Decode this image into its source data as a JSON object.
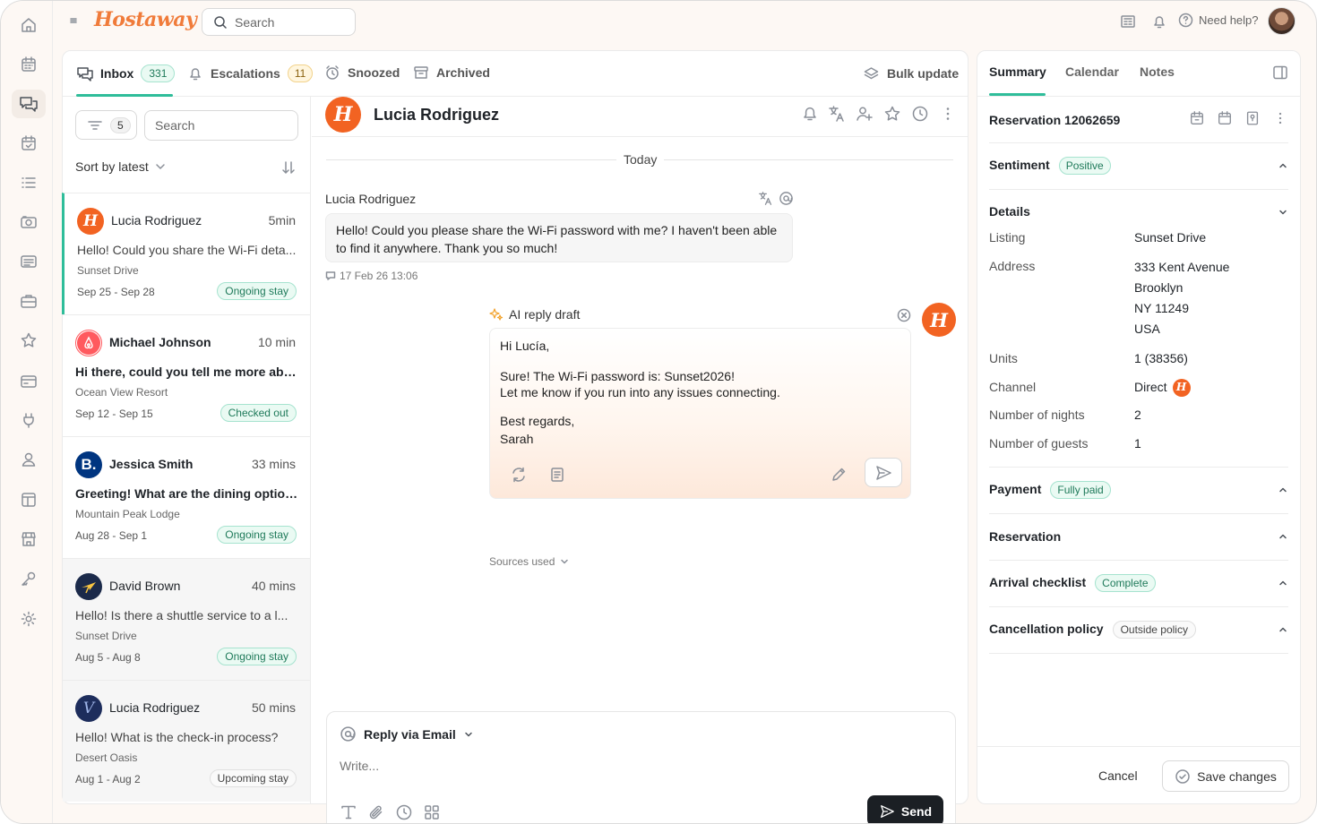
{
  "app": {
    "brand": "Hostaway",
    "accent": "#2fbd9a",
    "brand_color": "#f07b3a"
  },
  "topbar": {
    "search_placeholder": "Search",
    "help_label": "Need help?"
  },
  "rail_icons": [
    "home-icon",
    "calendar-icon",
    "chat-icon",
    "calendar-check-icon",
    "list-icon",
    "camera-icon",
    "invoice-icon",
    "briefcase-icon",
    "star-icon",
    "card-icon",
    "plug-icon",
    "user-icon",
    "layout-icon",
    "shop-icon",
    "key-icon",
    "gear-icon"
  ],
  "inbox_tabs": [
    {
      "label": "Inbox",
      "count": "331"
    },
    {
      "label": "Escalations",
      "count": "11"
    },
    {
      "label": "Snoozed"
    },
    {
      "label": "Archived"
    }
  ],
  "bulk_update": "Bulk update",
  "list": {
    "filter_count": "5",
    "search_placeholder": "Search",
    "sort_label": "Sort by latest",
    "conversations": [
      {
        "name": "Lucia Rodriguez",
        "time": "5min",
        "preview": "Hello! Could you share the Wi-Fi deta...",
        "property": "Sunset Drive",
        "dates": "Sep 25 - Sep 28",
        "status": "Ongoing stay",
        "channel": "hostaway"
      },
      {
        "name": "Michael Johnson",
        "time": "10 min",
        "preview": "Hi there, could you tell me more abo...",
        "property": "Ocean View Resort",
        "dates": "Sep 12 - Sep 15",
        "status": "Checked out",
        "channel": "airbnb"
      },
      {
        "name": "Jessica Smith",
        "time": "33 mins",
        "preview": "Greeting! What are the dining option...",
        "property": "Mountain Peak Lodge",
        "dates": "Aug 28 - Sep 1",
        "status": "Ongoing stay",
        "channel": "booking"
      },
      {
        "name": "David Brown",
        "time": "40 mins",
        "preview": "Hello! Is there a shuttle service to a l...",
        "property": "Sunset Drive",
        "dates": "Aug 5 - Aug 8",
        "status": "Ongoing stay",
        "channel": "expedia"
      },
      {
        "name": "Lucia Rodriguez",
        "time": "50 mins",
        "preview": "Hello! What is the check-in process?",
        "property": "Desert Oasis",
        "dates": "Aug 1 - Aug 2",
        "status": "Upcoming stay",
        "channel": "vrbo"
      }
    ]
  },
  "chat": {
    "guest_name": "Lucia Rodriguez",
    "day_divider": "Today",
    "sender": "Lucia Rodriguez",
    "message": "Hello! Could you please share the Wi-Fi password with me? I haven't been able to find it anywhere. Thank you so much!",
    "message_time": "17 Feb 26 13:06",
    "ai_label": "AI reply draft",
    "ai_draft": {
      "greeting": "Hi Lucía,",
      "line1": "Sure! The Wi-Fi password is: Sunset2026!",
      "line2": "Let me know if you run into any issues connecting.",
      "signoff": "Best regards,",
      "name": "Sarah"
    },
    "sources_label": "Sources used",
    "reply_via": "Reply via Email",
    "write_placeholder": "Write...",
    "send_label": "Send"
  },
  "right": {
    "tabs": [
      "Summary",
      "Calendar",
      "Notes"
    ],
    "reservation_title": "Reservation 12062659",
    "sentiment": {
      "label": "Sentiment",
      "value": "Positive"
    },
    "details": {
      "label": "Details",
      "listing_label": "Listing",
      "listing": "Sunset Drive",
      "address_label": "Address",
      "address": [
        "333 Kent Avenue",
        "Brooklyn",
        "NY 11249",
        "USA"
      ],
      "units_label": "Units",
      "units": "1 (38356)",
      "channel_label": "Channel",
      "channel": "Direct",
      "nights_label": "Number of nights",
      "nights": "2",
      "guests_label": "Number of guests",
      "guests": "1"
    },
    "payment": {
      "label": "Payment",
      "value": "Fully paid"
    },
    "reservation": {
      "label": "Reservation"
    },
    "arrival": {
      "label": "Arrival checklist",
      "value": "Complete"
    },
    "cancellation": {
      "label": "Cancellation policy",
      "value": "Outside policy"
    },
    "cancel_label": "Cancel",
    "save_label": "Save changes"
  }
}
